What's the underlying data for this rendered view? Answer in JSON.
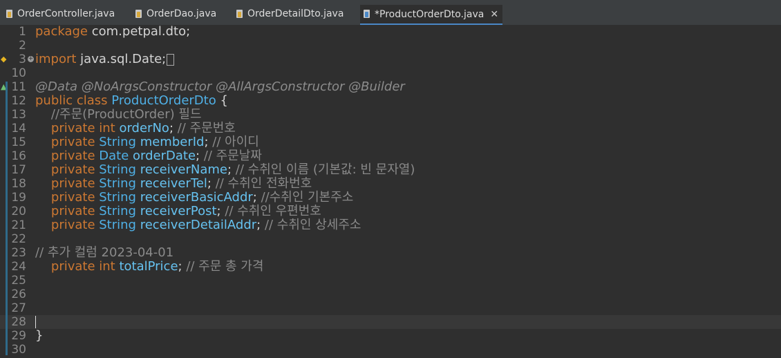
{
  "tabs": [
    {
      "label": "OrderController.java",
      "active": false
    },
    {
      "label": "OrderDao.java",
      "active": false
    },
    {
      "label": "OrderDetailDto.java",
      "active": false
    },
    {
      "label": "*ProductOrderDto.java",
      "active": true
    }
  ],
  "editor": {
    "current_line": 28,
    "lines": [
      {
        "n": "1",
        "segs": [
          [
            "kw",
            "package"
          ],
          [
            "plain",
            " com.petpal.dto;"
          ]
        ]
      },
      {
        "n": "2",
        "segs": []
      },
      {
        "n": "3",
        "segs": [
          [
            "kw",
            "import"
          ],
          [
            "plain",
            " java.sql.Date;"
          ]
        ]
      },
      {
        "n": "10",
        "segs": []
      },
      {
        "n": "11",
        "segs": [
          [
            "ann",
            "@Data @NoArgsConstructor @AllArgsConstructor @Builder"
          ]
        ]
      },
      {
        "n": "12",
        "segs": [
          [
            "kw",
            "public class "
          ],
          [
            "cls",
            "ProductOrderDto"
          ],
          [
            "plain",
            " {"
          ]
        ]
      },
      {
        "n": "13",
        "segs": [
          [
            "cmt",
            "    //주문(ProductOrder) 필드"
          ]
        ]
      },
      {
        "n": "14",
        "segs": [
          [
            "kw",
            "    private int "
          ],
          [
            "fld",
            "orderNo"
          ],
          [
            "plain",
            "; "
          ],
          [
            "cmt",
            "// 주문번호"
          ]
        ]
      },
      {
        "n": "15",
        "segs": [
          [
            "kw",
            "    private "
          ],
          [
            "cls",
            "String "
          ],
          [
            "fld",
            "memberId"
          ],
          [
            "plain",
            "; "
          ],
          [
            "cmt",
            "// 아이디"
          ]
        ]
      },
      {
        "n": "16",
        "segs": [
          [
            "kw",
            "    private "
          ],
          [
            "cls",
            "Date "
          ],
          [
            "fld",
            "orderDate"
          ],
          [
            "plain",
            "; "
          ],
          [
            "cmt",
            "// 주문날짜"
          ]
        ]
      },
      {
        "n": "17",
        "segs": [
          [
            "kw",
            "    private "
          ],
          [
            "cls",
            "String "
          ],
          [
            "fld",
            "receiverName"
          ],
          [
            "plain",
            "; "
          ],
          [
            "cmt",
            "// 수취인 이름 (기본값: 빈 문자열)"
          ]
        ]
      },
      {
        "n": "18",
        "segs": [
          [
            "kw",
            "    private "
          ],
          [
            "cls",
            "String "
          ],
          [
            "fld",
            "receiverTel"
          ],
          [
            "plain",
            "; "
          ],
          [
            "cmt",
            "// 수취인 전화번호"
          ]
        ]
      },
      {
        "n": "19",
        "segs": [
          [
            "kw",
            "    private "
          ],
          [
            "cls",
            "String "
          ],
          [
            "fld",
            "receiverBasicAddr"
          ],
          [
            "plain",
            "; "
          ],
          [
            "cmt",
            "//수취인 기본주소"
          ]
        ]
      },
      {
        "n": "20",
        "segs": [
          [
            "kw",
            "    private "
          ],
          [
            "cls",
            "String "
          ],
          [
            "fld",
            "receiverPost"
          ],
          [
            "plain",
            "; "
          ],
          [
            "cmt",
            "// 수취인 우편번호"
          ]
        ]
      },
      {
        "n": "21",
        "segs": [
          [
            "kw",
            "    private "
          ],
          [
            "cls",
            "String "
          ],
          [
            "fld",
            "receiverDetailAddr"
          ],
          [
            "plain",
            "; "
          ],
          [
            "cmt",
            "// 수취인 상세주소"
          ]
        ]
      },
      {
        "n": "22",
        "segs": []
      },
      {
        "n": "23",
        "segs": [
          [
            "cmt",
            "// 추가 컬럼 2023-04-01"
          ]
        ]
      },
      {
        "n": "24",
        "segs": [
          [
            "kw",
            "    private int "
          ],
          [
            "fld",
            "totalPrice"
          ],
          [
            "plain",
            "; "
          ],
          [
            "cmt",
            "// 주문 총 가격"
          ]
        ]
      },
      {
        "n": "25",
        "segs": []
      },
      {
        "n": "26",
        "segs": []
      },
      {
        "n": "27",
        "segs": []
      },
      {
        "n": "28",
        "segs": []
      },
      {
        "n": "29",
        "segs": [
          [
            "plain",
            "}"
          ]
        ]
      },
      {
        "n": "30",
        "segs": []
      }
    ]
  },
  "icons": {
    "fold": "fold-expand-icon",
    "warning": "lightbulb-warning-icon",
    "override": "override-triangle-icon"
  }
}
